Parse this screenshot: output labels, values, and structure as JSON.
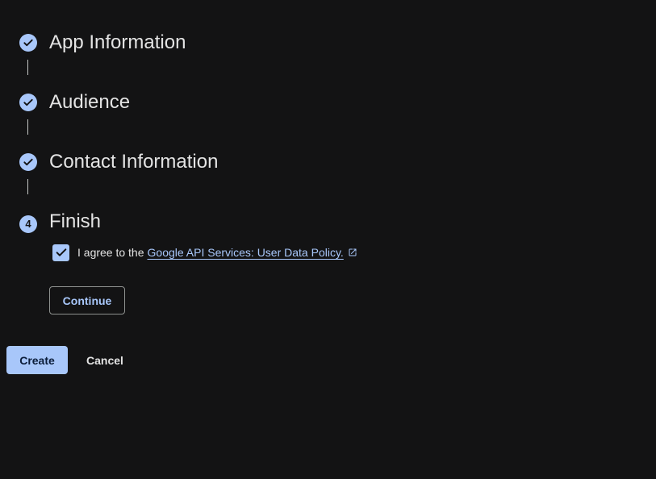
{
  "stepper": {
    "steps": [
      {
        "label": "App Information",
        "status": "complete",
        "icon": "check-icon"
      },
      {
        "label": "Audience",
        "status": "complete",
        "icon": "check-icon"
      },
      {
        "label": "Contact Information",
        "status": "complete",
        "icon": "check-icon"
      },
      {
        "label": "Finish",
        "status": "current",
        "number": "4"
      }
    ]
  },
  "finish": {
    "agree_prefix": "I agree to the",
    "policy_link": "Google API Services: User Data Policy.",
    "policy_link_icon": "open-in-new-icon",
    "agree_checked": true,
    "continue_label": "Continue"
  },
  "actions": {
    "create_label": "Create",
    "cancel_label": "Cancel"
  },
  "colors": {
    "background": "#131314",
    "accent": "#a8c7fa",
    "text": "#e3e3e3"
  }
}
